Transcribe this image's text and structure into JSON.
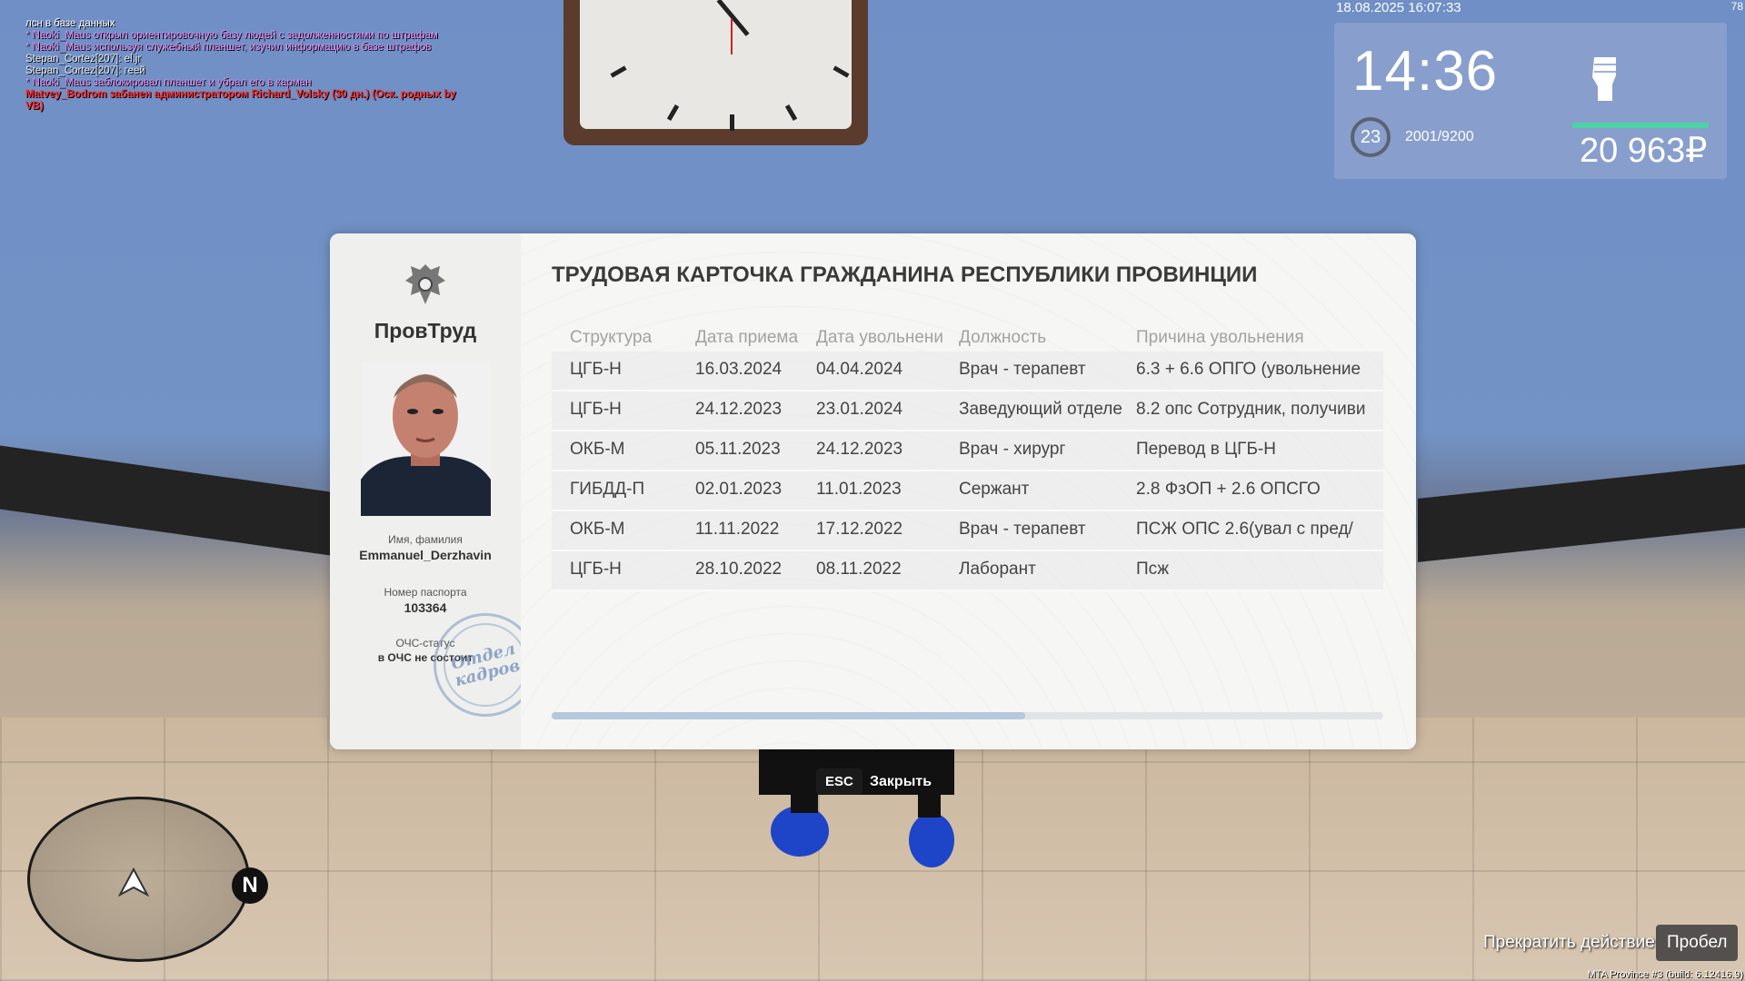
{
  "chat": [
    {
      "text": "лсн в базе данных",
      "type": "c1"
    },
    {
      "text": "* Naoki_Maus открыл ориентировочную базу людей с задолженностями по штрафам",
      "type": "c2"
    },
    {
      "text": "* Naoki_Maus используя служебный планшет, изучил информацию в базе штрафов",
      "type": "c2"
    },
    {
      "text": "Stepan_Cortez[207]: el.jr",
      "type": "c3"
    },
    {
      "text": "Stepan_Cortez[207]: геей",
      "type": "c3"
    },
    {
      "text": "* Naoki_Maus заблокировал планшет и убрал его в карман",
      "type": "c2"
    },
    {
      "text": "Matvey_Bodrom забанен администратором Richard_Volsky (30 дн.) (Оск. родных by VB)",
      "type": "c4"
    }
  ],
  "hud": {
    "datetime": "18.08.2025 16:07:33",
    "fps": "78",
    "time": "14:36",
    "level": "23",
    "xp": "2001/9200",
    "money": "20 963₽",
    "icon": "fist-icon"
  },
  "card": {
    "brand": "ПровТруд",
    "title": "ТРУДОВАЯ КАРТОЧКА ГРАЖДАНИНА РЕСПУБЛИКИ ПРОВИНЦИИ",
    "name_label": "Имя, фамилия",
    "name": "Emmanuel_Derzhavin",
    "passport_label": "Номер паспорта",
    "passport": "103364",
    "ochs_label": "ОЧС-статус",
    "ochs": "в ОЧС не состоит",
    "stamp_line1": "Отдел",
    "stamp_line2": "кадров",
    "columns": [
      "Структура",
      "Дата приема",
      "Дата увольнени",
      "Должность",
      "Причина увольнения"
    ],
    "rows": [
      [
        "ЦГБ-Н",
        "16.03.2024",
        "04.04.2024",
        "Врач - терапевт",
        "6.3 + 6.6 ОПГО (увольнение"
      ],
      [
        "ЦГБ-Н",
        "24.12.2023",
        "23.01.2024",
        "Заведующий отделе",
        "8.2 опс Сотрудник, получиви"
      ],
      [
        "ОКБ-М",
        "05.11.2023",
        "24.12.2023",
        "Врач - хирург",
        "Перевод в ЦГБ-Н"
      ],
      [
        "ГИБДД-П",
        "02.01.2023",
        "11.01.2023",
        "Сержант",
        "2.8 ФзОП + 2.6 ОПСГО"
      ],
      [
        "ОКБ-М",
        "11.11.2022",
        "17.12.2022",
        "Врач - терапевт",
        "ПСЖ ОПС 2.6(увал с пред/"
      ],
      [
        "ЦГБ-Н",
        "28.10.2022",
        "08.11.2022",
        "Лаборант",
        "Псж"
      ]
    ]
  },
  "hints": {
    "esc_key": "ESC",
    "esc_label": "Закрыть",
    "stop_label": "Прекратить действие",
    "stop_key": "Пробел"
  },
  "radar": {
    "north": "N"
  },
  "build": "MTA Province #3 (build: 6.12416.9)"
}
